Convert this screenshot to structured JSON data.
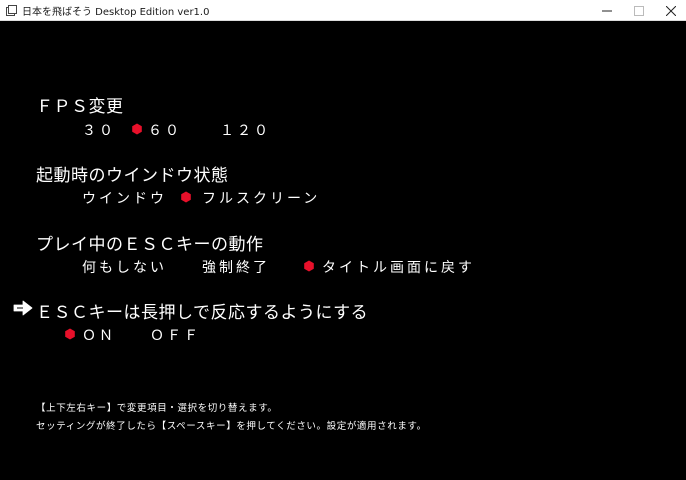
{
  "window": {
    "title": "日本を飛ばそう Desktop Edition ver1.0",
    "icon": "window-app-icon",
    "controls": [
      "minimize-icon",
      "maximize-icon",
      "close-icon"
    ]
  },
  "settings": [
    {
      "heading": "ＦＰＳ変更",
      "options": [
        "３０",
        "６０",
        "１２０"
      ],
      "selected": 1
    },
    {
      "heading": "起動時のウインドウ状態",
      "options": [
        "ウインドウ",
        "フルスクリーン"
      ],
      "selected": 1
    },
    {
      "heading": "プレイ中のＥＳＣキーの動作",
      "options": [
        "何もしない",
        "強制終了",
        "タイトル画面に戻す"
      ],
      "selected": 2
    },
    {
      "heading": "ＥＳＣキーは長押しで反応するようにする",
      "options": [
        "ＯＮ",
        "ＯＦＦ"
      ],
      "selected": 0
    }
  ],
  "cursor": {
    "icon": "pointing-hand-arrow-icon",
    "current_setting": 3
  },
  "footer": {
    "line1": "【上下左右キー】で変更項目・選択を切り替えます。",
    "line2": "セッティングが終了したら【スペースキー】を押してください。設定が適用されます。"
  },
  "colors": {
    "background": "#000000",
    "text": "#ffffff",
    "marker": "#e8102a",
    "titlebar": "#ffffff"
  }
}
